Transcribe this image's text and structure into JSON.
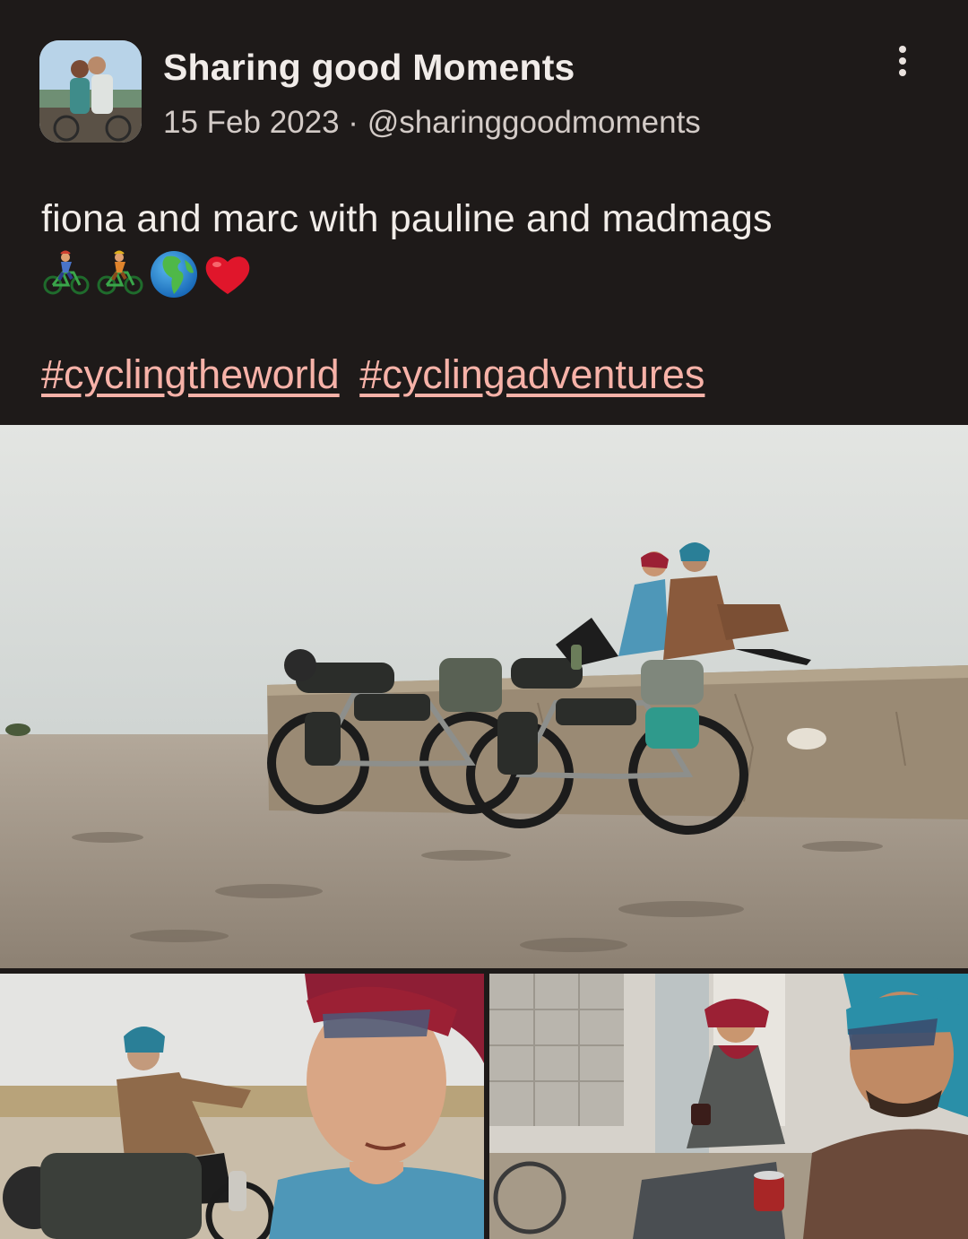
{
  "post": {
    "author": "Sharing good Moments",
    "date": "15 Feb 2023",
    "separator": "·",
    "handle": "@sharinggoodmoments",
    "caption": "fiona and marc with pauline and madmags",
    "emojis": [
      "bicycle-rider-icon",
      "bicycle-rider-icon",
      "globe-icon",
      "heart-icon"
    ],
    "hashtags": [
      "#cyclingtheworld",
      "#cyclingadventures"
    ]
  },
  "photos": [
    {
      "subject": "two cyclists resting on a concrete wall with loaded touring bikes"
    },
    {
      "subject": "selfie of a cyclist in headscarf with rider on bike behind"
    },
    {
      "subject": "selfie of two cyclists drinking tea"
    }
  ],
  "colors": {
    "background": "#1e1a19",
    "text": "#f1ece9",
    "muted": "#d3cbc7",
    "hashtag": "#f7b2a8"
  }
}
